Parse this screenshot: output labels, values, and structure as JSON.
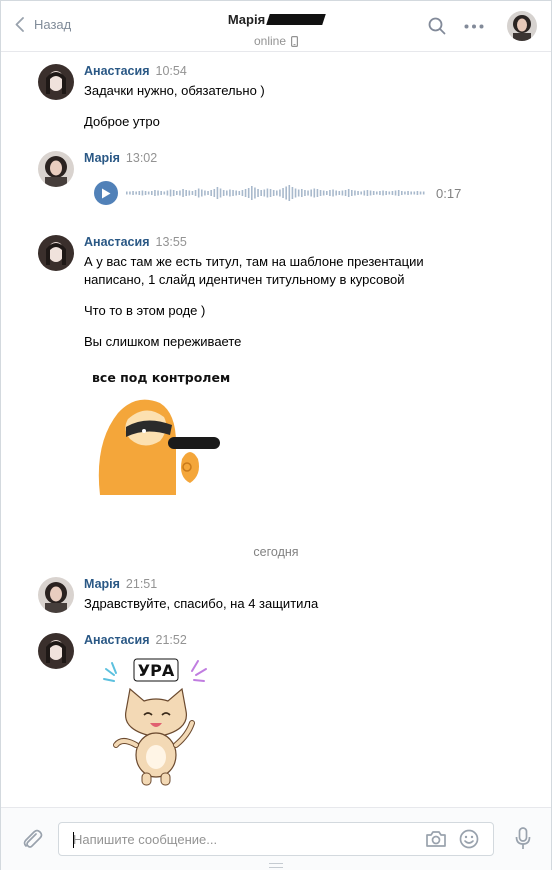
{
  "header": {
    "back_label": "Назад",
    "contact_name": "Марія",
    "status": "online"
  },
  "messages": [
    {
      "author": "Анастасия",
      "time": "10:54",
      "lines": [
        "Задачки нужно, обязательно )",
        "Доброе утро"
      ]
    },
    {
      "author": "Марія",
      "time": "13:02",
      "voice_duration": "0:17"
    },
    {
      "author": "Анастасия",
      "time": "13:55",
      "lines": [
        "А у вас там же есть титул, там на шаблоне презентации",
        "написано, 1 слайд идентичен титульному в курсовой",
        "Что то в этом роде )",
        "Вы слишком переживаете"
      ],
      "sticker_caption": "все под контролем"
    },
    {
      "author": "Марія",
      "time": "21:51",
      "lines": [
        "Здравствуйте, спасибо, на 4 защитила"
      ]
    },
    {
      "author": "Анастасия",
      "time": "21:52",
      "sticker_caption": "УРА"
    }
  ],
  "date_separator": "сегодня",
  "composer": {
    "placeholder": "Напишите сообщение..."
  },
  "colors": {
    "author": "#2a5885",
    "accent": "#5181b8",
    "muted": "#939393",
    "sloth": "#f4a63a",
    "cat": "#f3d9b5"
  },
  "icons": [
    "back-chevron-icon",
    "phone-icon",
    "search-icon",
    "more-icon",
    "paperclip-icon",
    "camera-icon",
    "emoji-icon",
    "microphone-icon",
    "play-icon"
  ]
}
